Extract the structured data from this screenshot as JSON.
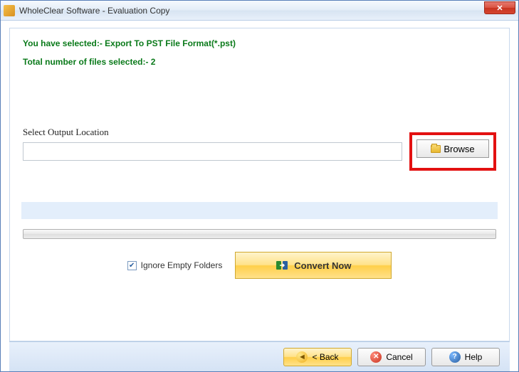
{
  "window": {
    "title": "WholeClear Software - Evaluation Copy"
  },
  "info": {
    "selected_format": "You have selected:- Export To PST File Format(*.pst)",
    "file_count": "Total number of files selected:- 2"
  },
  "output": {
    "label": "Select Output Location",
    "path": "",
    "browse_label": "Browse"
  },
  "options": {
    "ignore_empty": "Ignore Empty Folders",
    "ignore_empty_checked": true
  },
  "actions": {
    "convert": "Convert Now"
  },
  "footer": {
    "back": "< Back",
    "cancel": "Cancel",
    "help": "Help"
  }
}
